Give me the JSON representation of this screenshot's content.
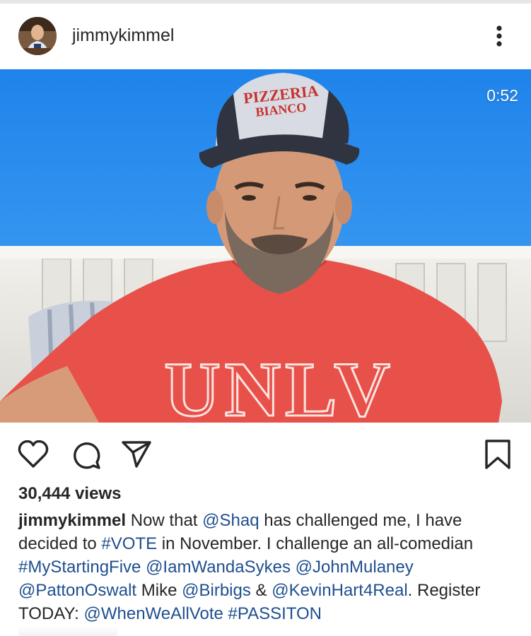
{
  "post": {
    "username": "jimmykimmel",
    "duration": "0:52",
    "views": "30,444 views",
    "caption_segments": [
      {
        "t": "jimmykimmel",
        "kind": "user"
      },
      {
        "t": " Now that ",
        "kind": "text"
      },
      {
        "t": "@Shaq",
        "kind": "link"
      },
      {
        "t": " has challenged me, I have decided to ",
        "kind": "text"
      },
      {
        "t": "#VOTE",
        "kind": "link"
      },
      {
        "t": " in November. I challenge an all-comedian ",
        "kind": "text"
      },
      {
        "t": "#MyStartingFive",
        "kind": "link"
      },
      {
        "t": " ",
        "kind": "text"
      },
      {
        "t": "@IamWandaSykes",
        "kind": "link"
      },
      {
        "t": " ",
        "kind": "text"
      },
      {
        "t": "@JohnMulaney",
        "kind": "link"
      },
      {
        "t": " ",
        "kind": "text"
      },
      {
        "t": "@PattonOswalt",
        "kind": "link"
      },
      {
        "t": " Mike ",
        "kind": "text"
      },
      {
        "t": "@Birbigs",
        "kind": "link"
      },
      {
        "t": " & ",
        "kind": "text"
      },
      {
        "t": "@KevinHart4Real",
        "kind": "link"
      },
      {
        "t": ". Register TODAY: ",
        "kind": "text"
      },
      {
        "t": "@WhenWeAllVote",
        "kind": "link"
      },
      {
        "t": " ",
        "kind": "text"
      },
      {
        "t": "#PASSITON",
        "kind": "link"
      }
    ],
    "video": {
      "hat_text_line1": "PIZZERIA",
      "hat_text_line2": "BIANCO",
      "shirt_text": "UNLV"
    }
  },
  "colors": {
    "sky": "#2a8ff0",
    "shirt": "#e8504a",
    "link": "#1f4f8f",
    "text": "#262626"
  },
  "icons": {
    "more": "more-vertical-icon",
    "like": "heart-icon",
    "comment": "comment-icon",
    "share": "send-icon",
    "save": "bookmark-icon"
  }
}
